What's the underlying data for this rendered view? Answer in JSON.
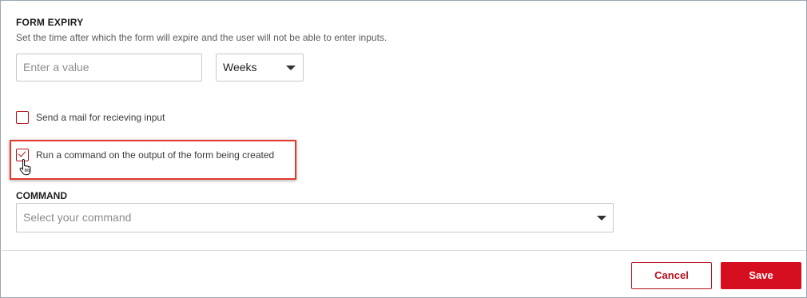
{
  "form_expiry": {
    "title": "FORM EXPIRY",
    "description": "Set the time after which the form will expire and the user will not be able to enter inputs.",
    "value_input": {
      "value": "",
      "placeholder": "Enter a value"
    },
    "unit_select": {
      "selected": "Weeks"
    }
  },
  "options": {
    "send_mail": {
      "label": "Send a mail for recieving input",
      "checked": false
    },
    "run_command": {
      "label": "Run a command on the output of the form being created",
      "checked": true
    }
  },
  "command": {
    "title": "COMMAND",
    "select": {
      "placeholder": "Select your command"
    }
  },
  "footer": {
    "cancel_label": "Cancel",
    "save_label": "Save"
  },
  "colors": {
    "accent": "#d50f1f",
    "highlight_border": "#e23b2f"
  },
  "icons": {
    "cursor": "hand-pointer-icon",
    "dropdown": "caret-down-icon"
  }
}
